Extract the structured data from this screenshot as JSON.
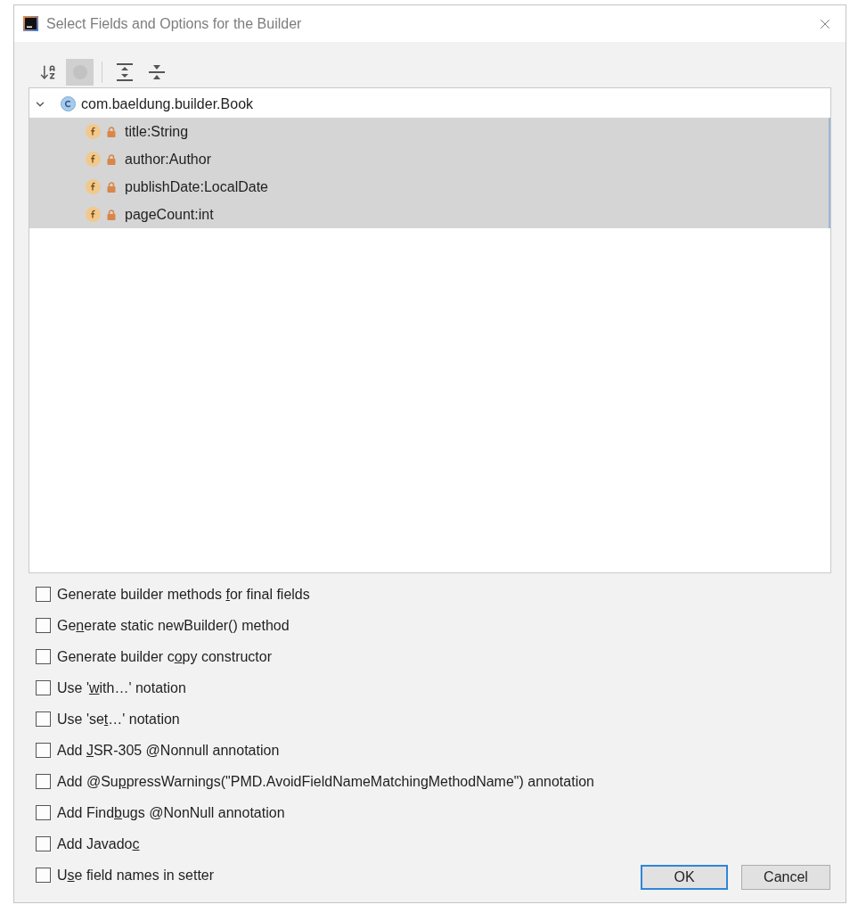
{
  "window": {
    "title": "Select Fields and Options for the Builder"
  },
  "toolbar": [
    {
      "kind": "sort",
      "pressed": false
    },
    {
      "kind": "toggle",
      "pressed": true
    },
    {
      "kind": "separator"
    },
    {
      "kind": "expand_all",
      "pressed": false
    },
    {
      "kind": "collapse_all",
      "pressed": false
    }
  ],
  "tree": {
    "root": {
      "kind": "class",
      "label": "com.baeldung.builder.Book",
      "expanded": true,
      "selected": false,
      "children": [
        {
          "kind": "field",
          "label": "title:String",
          "private": true,
          "selected": true
        },
        {
          "kind": "field",
          "label": "author:Author",
          "private": true,
          "selected": true
        },
        {
          "kind": "field",
          "label": "publishDate:LocalDate",
          "private": true,
          "selected": true
        },
        {
          "kind": "field",
          "label": "pageCount:int",
          "private": true,
          "selected": true
        }
      ]
    }
  },
  "options": [
    {
      "before": "Generate builder methods ",
      "key": "f",
      "after": "or final fields",
      "checked": false
    },
    {
      "before": "Ge",
      "key": "n",
      "after": "erate static newBuilder() method",
      "checked": false
    },
    {
      "before": "Generate builder c",
      "key": "o",
      "after": "py constructor",
      "checked": false
    },
    {
      "before": "Use '",
      "key": "w",
      "after": "ith…' notation",
      "checked": false
    },
    {
      "before": "Use 'se",
      "key": "t",
      "after": "…' notation",
      "checked": false
    },
    {
      "before": "Add ",
      "key": "J",
      "after": "SR-305 @Nonnull annotation",
      "checked": false
    },
    {
      "before": "Add @Su",
      "key": "p",
      "after": "pressWarnings(\"PMD.AvoidFieldNameMatchingMethodName\") annotation",
      "checked": false
    },
    {
      "before": "Add Find",
      "key": "b",
      "after": "ugs @NonNull annotation",
      "checked": false
    },
    {
      "before": "Add Javado",
      "key": "c",
      "checked": false
    },
    {
      "before": "U",
      "key": "s",
      "after": "e field names in setter",
      "checked": false
    }
  ],
  "buttons": [
    {
      "label": "OK",
      "default": true
    },
    {
      "label": "Cancel",
      "default": false
    }
  ]
}
